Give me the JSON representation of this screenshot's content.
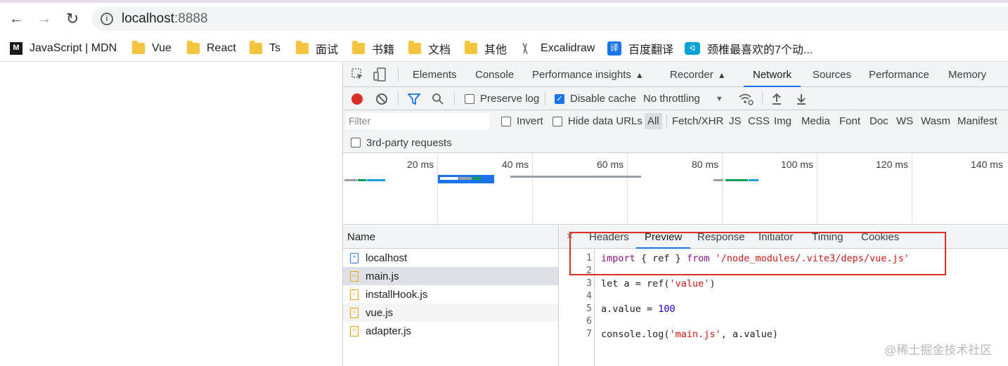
{
  "browser": {
    "address": {
      "host": "localhost",
      "port": ":8888"
    },
    "nav": {
      "back": "←",
      "forward": "→",
      "reload": "↻"
    }
  },
  "bookmarks": [
    {
      "label": "JavaScript | MDN",
      "icon": "mdn-icon"
    },
    {
      "label": "Vue",
      "icon": "folder-icon"
    },
    {
      "label": "React",
      "icon": "folder-icon"
    },
    {
      "label": "Ts",
      "icon": "folder-icon"
    },
    {
      "label": "面试",
      "icon": "folder-icon"
    },
    {
      "label": "书籍",
      "icon": "folder-icon"
    },
    {
      "label": "文档",
      "icon": "folder-icon"
    },
    {
      "label": "其他",
      "icon": "folder-icon"
    },
    {
      "label": "Excalidraw",
      "icon": "excalidraw-icon"
    },
    {
      "label": "百度翻译",
      "icon": "baidu-translate-icon"
    },
    {
      "label": "颈椎最喜欢的7个动...",
      "icon": "bilibili-icon"
    }
  ],
  "devtools": {
    "tabs": [
      "Elements",
      "Console",
      "Performance insights",
      "Recorder",
      "Network",
      "Sources",
      "Performance",
      "Memory"
    ],
    "active_tab": "Network",
    "toolbar": {
      "preserve_log": "Preserve log",
      "disable_cache": "Disable cache",
      "throttling": "No throttling"
    },
    "filter": {
      "placeholder": "Filter",
      "invert": "Invert",
      "hide_data_urls": "Hide data URLs",
      "types": [
        "All",
        "Fetch/XHR",
        "JS",
        "CSS",
        "Img",
        "Media",
        "Font",
        "Doc",
        "WS",
        "Wasm",
        "Manifest"
      ],
      "third_party": "3rd-party requests"
    },
    "timeline": {
      "ticks": [
        "20 ms",
        "40 ms",
        "60 ms",
        "80 ms",
        "100 ms",
        "120 ms",
        "140 ms"
      ]
    },
    "name_header": "Name",
    "files": [
      {
        "name": "localhost",
        "type": "doc"
      },
      {
        "name": "main.js",
        "type": "js"
      },
      {
        "name": "installHook.js",
        "type": "js"
      },
      {
        "name": "vue.js",
        "type": "js"
      },
      {
        "name": "adapter.js",
        "type": "js"
      }
    ],
    "selected_file": "main.js",
    "detail_tabs": [
      "Headers",
      "Preview",
      "Response",
      "Initiator",
      "Timing",
      "Cookies"
    ],
    "active_detail_tab": "Preview",
    "close": "×",
    "code": {
      "line_numbers": [
        "1",
        "2",
        "3",
        "4",
        "5",
        "6",
        "7"
      ],
      "l1_kw": "import",
      "l1_mid": " { ref } ",
      "l1_kw2": "from",
      "l1_sp": " ",
      "l1_str": "'/node_modules/.vite3/deps/vue.js'",
      "l3_a": "let a = ref(",
      "l3_str": "'value'",
      "l3_b": ")",
      "l5_a": "a.value = ",
      "l5_num": "100",
      "l7_a": "console.log(",
      "l7_str": "'main.js'",
      "l7_b": ", a.value)"
    }
  },
  "watermark": "@稀土掘金技术社区",
  "colors": {
    "accent": "#1a73e8",
    "record": "#d93025",
    "highlight_box": "#d93025"
  }
}
